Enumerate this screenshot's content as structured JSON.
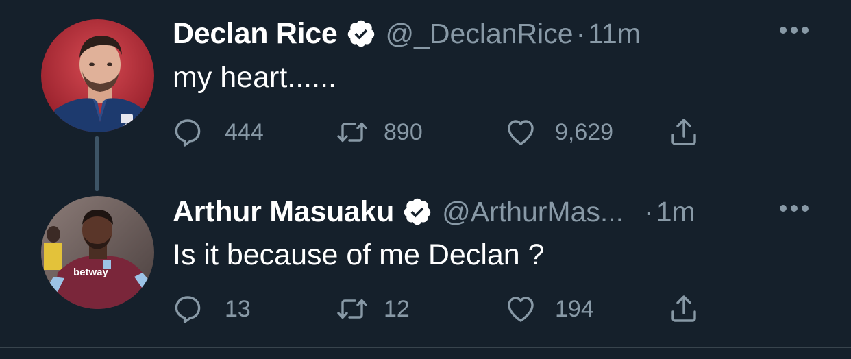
{
  "colors": {
    "background": "#15202b",
    "primary_text": "#ffffff",
    "secondary_text": "#8899a6",
    "thread_line": "#3d5466"
  },
  "tweets": [
    {
      "display_name": "Declan Rice",
      "verified_icon": "verified-badge-icon",
      "handle": "@_DeclanRice",
      "separator": "·",
      "time": "11m",
      "text": "my heart......",
      "replies": "444",
      "retweets": "890",
      "likes": "9,629"
    },
    {
      "display_name": "Arthur Masuaku",
      "verified_icon": "verified-badge-icon",
      "handle": "@ArthurMas...",
      "separator": "·",
      "time": "1m",
      "text": "Is it because of me Declan ?",
      "replies": "13",
      "retweets": "12",
      "likes": "194",
      "avatar_jersey_text": "betway"
    }
  ]
}
